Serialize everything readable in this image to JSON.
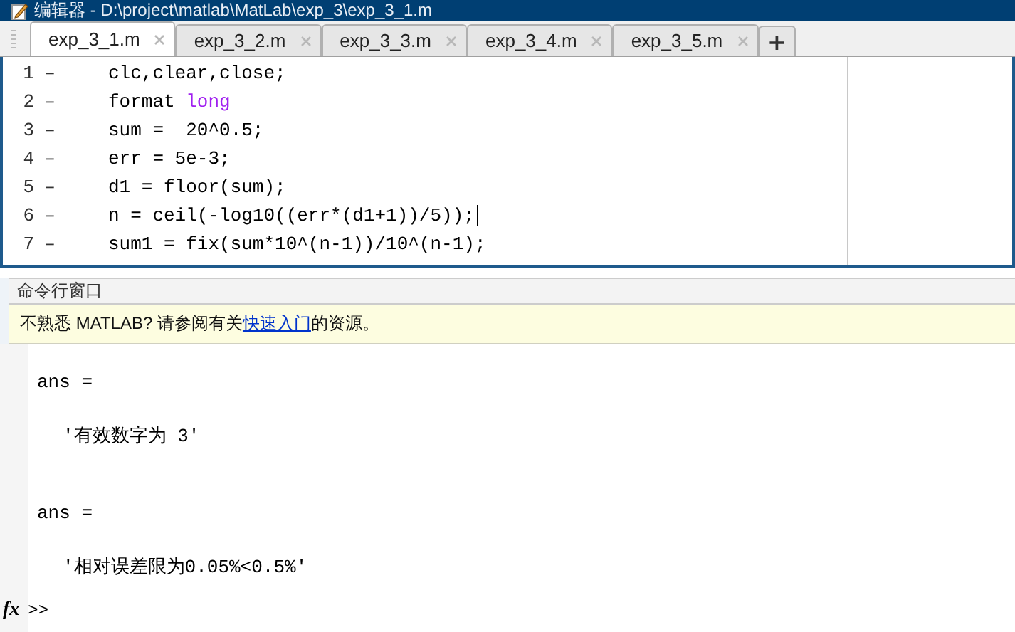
{
  "window": {
    "title": "编辑器 - D:\\project\\matlab\\MatLab\\exp_3\\exp_3_1.m"
  },
  "tabs": [
    {
      "label": "exp_3_1.m",
      "selected": true
    },
    {
      "label": "exp_3_2.m",
      "selected": false
    },
    {
      "label": "exp_3_3.m",
      "selected": false
    },
    {
      "label": "exp_3_4.m",
      "selected": false
    },
    {
      "label": "exp_3_5.m",
      "selected": false
    }
  ],
  "new_tab_button": "+",
  "editor": {
    "lines": [
      {
        "number": "1",
        "marker": "–",
        "segments": [
          {
            "kind": "plain",
            "text": "clc,clear,close;"
          }
        ]
      },
      {
        "number": "2",
        "marker": "–",
        "segments": [
          {
            "kind": "plain",
            "text": "format "
          },
          {
            "kind": "keyword",
            "text": "long"
          }
        ]
      },
      {
        "number": "3",
        "marker": "–",
        "segments": [
          {
            "kind": "plain",
            "text": "sum =  20^0.5;"
          }
        ]
      },
      {
        "number": "4",
        "marker": "–",
        "segments": [
          {
            "kind": "plain",
            "text": "err = 5e-3;"
          }
        ]
      },
      {
        "number": "5",
        "marker": "–",
        "segments": [
          {
            "kind": "plain",
            "text": "d1 = floor(sum);"
          }
        ]
      },
      {
        "number": "6",
        "marker": "–",
        "cursor": true,
        "segments": [
          {
            "kind": "plain",
            "text": "n = ceil(-log10((err*(d1+1))/5));"
          }
        ]
      },
      {
        "number": "7",
        "marker": "–",
        "segments": [
          {
            "kind": "plain",
            "text": "sum1 = fix(sum*10^(n-1))/10^(n-1);"
          }
        ]
      }
    ]
  },
  "command_window": {
    "title": "命令行窗口",
    "banner": {
      "before": "不熟悉 MATLAB? 请参阅有关",
      "link": "快速入门",
      "after": "的资源。"
    },
    "output": [
      {
        "kind": "ans",
        "text": "ans ="
      },
      {
        "kind": "value",
        "text": "'有效数字为 3'"
      },
      {
        "kind": "ans",
        "text": "ans ="
      },
      {
        "kind": "value",
        "text": "'相对误差限为0.05%<0.5%'"
      }
    ],
    "prompt": {
      "icon": "fx",
      "text": ">>"
    }
  }
}
